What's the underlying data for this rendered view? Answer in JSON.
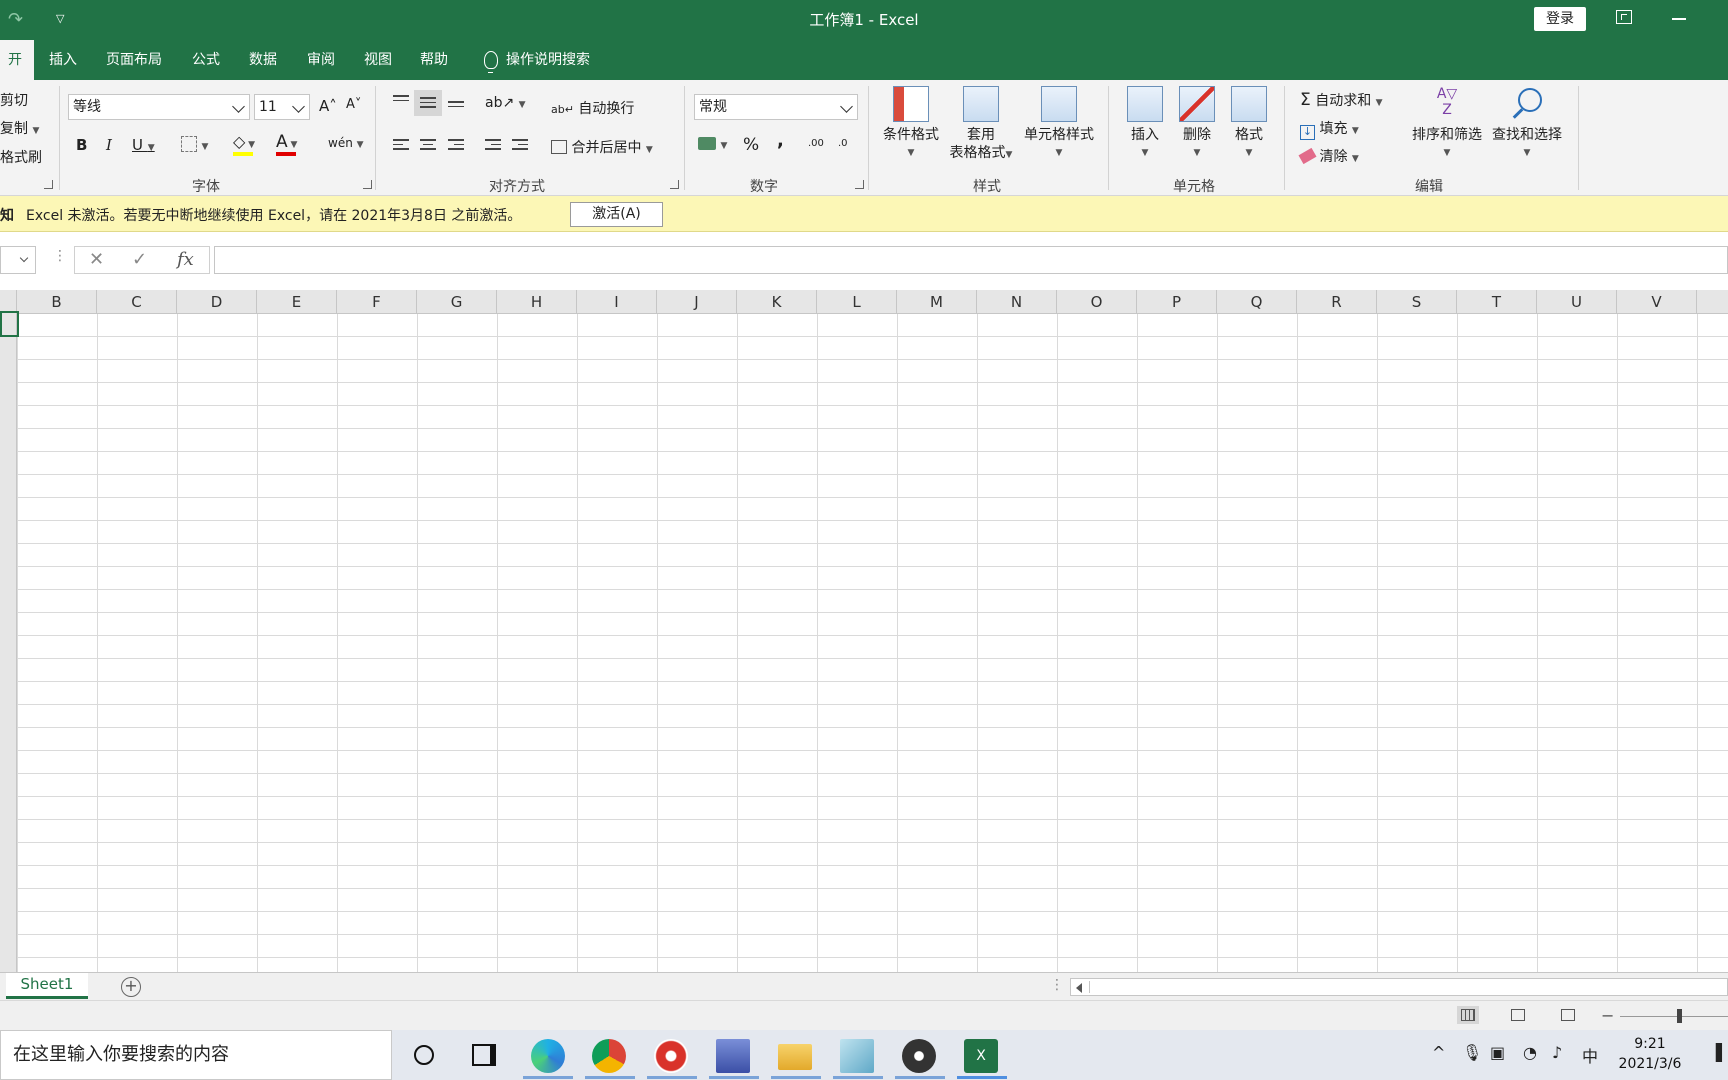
{
  "window": {
    "title": "工作簿1  -  Excel",
    "login_label": "登录"
  },
  "tabs": [
    {
      "label": "开始",
      "active": true
    },
    {
      "label": "插入"
    },
    {
      "label": "页面布局"
    },
    {
      "label": "公式"
    },
    {
      "label": "数据"
    },
    {
      "label": "审阅"
    },
    {
      "label": "视图"
    },
    {
      "label": "帮助"
    }
  ],
  "tell_me": "操作说明搜索",
  "clipboard": {
    "cut": "剪切",
    "copy": "复制",
    "format_painter": "格式刷"
  },
  "font": {
    "name": "等线",
    "size": "11",
    "grow": "A˄",
    "shrink": "A˅",
    "bold": "B",
    "italic": "I",
    "underline": "U",
    "font_color_letter": "A",
    "phonetic": "wén",
    "group_label": "字体",
    "fill_color": "#ffff00",
    "text_color": "#e00000"
  },
  "alignment": {
    "wrap_text": "自动换行",
    "merge_center": "合并后居中",
    "group_label": "对齐方式"
  },
  "number": {
    "format": "常规",
    "percent": "%",
    "comma": ",",
    "inc_decimal": ".00",
    "dec_decimal": ".0",
    "group_label": "数字"
  },
  "styles": {
    "conditional": "条件格式",
    "table_format_1": "套用",
    "table_format_2": "表格格式",
    "cell_styles": "单元格样式",
    "group_label": "样式"
  },
  "cells": {
    "insert": "插入",
    "delete": "删除",
    "format": "格式",
    "group_label": "单元格"
  },
  "editing": {
    "autosum": "自动求和",
    "fill": "填充",
    "clear": "清除",
    "sort_filter": "排序和筛选",
    "find_select": "查找和选择",
    "group_label": "编辑"
  },
  "notification": {
    "label": "知",
    "message": "Excel 未激活。若要无中断地继续使用 Excel，请在 2021年3月8日 之前激活。",
    "button": "激活(A)"
  },
  "formula_bar": {
    "cancel": "✕",
    "enter": "✓",
    "fx": "fx",
    "value": ""
  },
  "columns": [
    "B",
    "C",
    "D",
    "E",
    "F",
    "G",
    "H",
    "I",
    "J",
    "K",
    "L",
    "M",
    "N",
    "O",
    "P",
    "Q",
    "R",
    "S",
    "T",
    "U",
    "V"
  ],
  "sheets": [
    {
      "name": "Sheet1",
      "active": true
    }
  ],
  "taskbar": {
    "search_placeholder": "在这里输入你要搜索的内容",
    "ime": "中",
    "time": "9:21",
    "date": "2021/3/6"
  },
  "colors": {
    "excel_green": "#217346",
    "notify_yellow": "#fcf7b6"
  }
}
